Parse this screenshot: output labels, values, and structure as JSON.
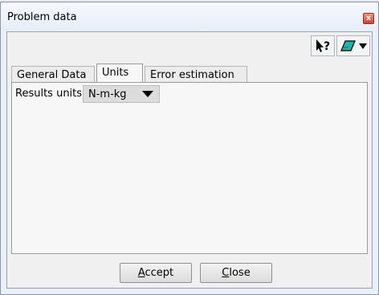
{
  "window": {
    "title": "Problem data",
    "close_glyph": "x"
  },
  "toolbar": {
    "help_icon": "context-help-icon",
    "layer_icon": "layer-icon",
    "help_glyph": "?",
    "accent": "#1fb5a8"
  },
  "tabs": [
    {
      "label": "General Data",
      "active": false
    },
    {
      "label": "Units",
      "active": true
    },
    {
      "label": "Error estimation",
      "active": false
    }
  ],
  "units": {
    "label": "Results units",
    "value": "N-m-kg"
  },
  "buttons": {
    "accept": {
      "mnemonic": "A",
      "rest": "ccept"
    },
    "close": {
      "mnemonic": "C",
      "rest": "lose"
    }
  }
}
